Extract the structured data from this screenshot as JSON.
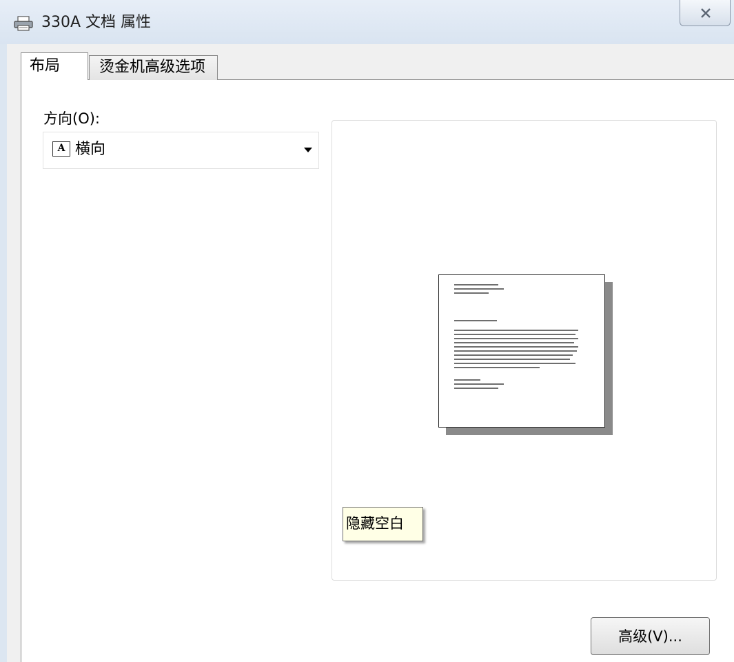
{
  "window": {
    "title": "330A 文档 属性",
    "icon": "printer-icon",
    "close_icon": "close-icon"
  },
  "tabs": [
    {
      "label": "布局",
      "active": true
    },
    {
      "label": "烫金机高级选项",
      "active": false
    }
  ],
  "layout": {
    "orientation_label": "方向(O):",
    "orientation_value": "横向",
    "orientation_icon": "landscape-page-icon",
    "orientation_icon_glyph": "A",
    "preview_tooltip": "隐藏空白",
    "advanced_button": "高级(V)..."
  }
}
